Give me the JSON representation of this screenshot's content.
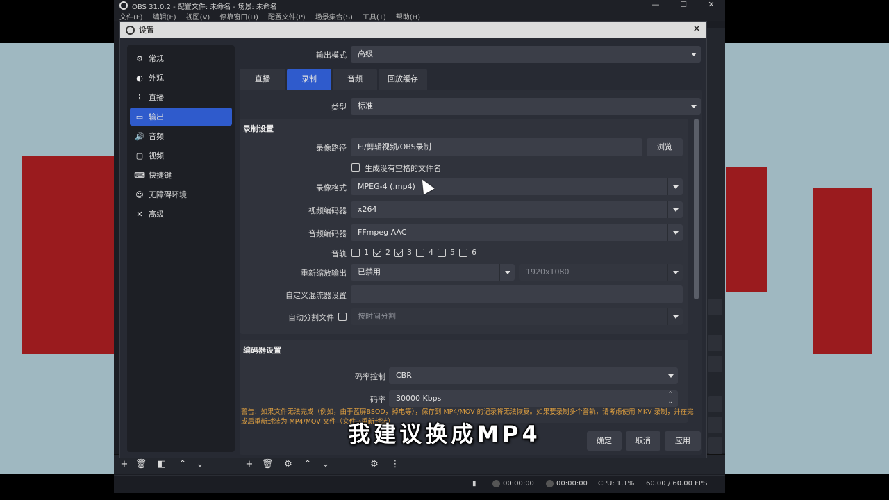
{
  "app": {
    "title": "OBS 31.0.2 - 配置文件: 未命名 - 场景: 未命名",
    "menu": [
      "文件(F)",
      "编辑(E)",
      "视图(V)",
      "停靠窗口(D)",
      "配置文件(P)",
      "场景集合(S)",
      "工具(T)",
      "帮助(H)"
    ],
    "window_controls": [
      "—",
      "☐",
      "✕"
    ],
    "status": {
      "rec_time": "00:00:00",
      "stream_time": "00:00:00",
      "cpu": "CPU: 1.1%",
      "fps": "60.00 / 60.00 FPS"
    }
  },
  "dialog": {
    "title": "设置",
    "close": "✕",
    "sidebar": [
      {
        "label": "常规",
        "icon": "gear-icon",
        "glyph": "⚙"
      },
      {
        "label": "外观",
        "icon": "appearance-icon",
        "glyph": "◐"
      },
      {
        "label": "直播",
        "icon": "broadcast-icon",
        "glyph": "⌇"
      },
      {
        "label": "输出",
        "icon": "output-icon",
        "glyph": "▭",
        "active": true
      },
      {
        "label": "音频",
        "icon": "speaker-icon",
        "glyph": "🔊"
      },
      {
        "label": "视频",
        "icon": "monitor-icon",
        "glyph": "▢"
      },
      {
        "label": "快捷键",
        "icon": "keyboard-icon",
        "glyph": "⌨"
      },
      {
        "label": "无障碍环境",
        "icon": "accessibility-icon",
        "glyph": "☺"
      },
      {
        "label": "高级",
        "icon": "tools-icon",
        "glyph": "✕"
      }
    ],
    "output_mode_label": "输出模式",
    "output_mode_value": "高级",
    "tabs": [
      "直播",
      "录制",
      "音频",
      "回放缓存"
    ],
    "active_tab": 1,
    "type_label": "类型",
    "type_value": "标准",
    "recording": {
      "group_title": "录制设置",
      "path_label": "录像路径",
      "path_value": "F:/剪辑视频/OBS录制",
      "browse": "浏览",
      "nospace_label": "生成没有空格的文件名",
      "format_label": "录像格式",
      "format_value": "MPEG-4 (.mp4)",
      "video_encoder_label": "视频编码器",
      "video_encoder_value": "x264",
      "audio_encoder_label": "音频编码器",
      "audio_encoder_value": "FFmpeg AAC",
      "tracks_label": "音轨",
      "tracks": [
        {
          "n": "1",
          "checked": false
        },
        {
          "n": "2",
          "checked": true
        },
        {
          "n": "3",
          "checked": true
        },
        {
          "n": "4",
          "checked": false
        },
        {
          "n": "5",
          "checked": false
        },
        {
          "n": "6",
          "checked": false
        }
      ],
      "rescale_label": "重新缩放输出",
      "rescale_value": "已禁用",
      "rescale_res": "1920x1080",
      "mux_label": "自定义混流器设置",
      "split_label": "自动分割文件",
      "split_value": "按时间分割"
    },
    "encoder": {
      "group_title": "编码器设置",
      "rate_control_label": "码率控制",
      "rate_control_value": "CBR",
      "bitrate_label": "码率",
      "bitrate_value": "30000 Kbps"
    },
    "warning": "警告：如果文件无法完成（例如，由于蓝屏BSOD，掉电等），保存到 MP4/MOV 的记录将无法恢复。如果要录制多个音轨，请考虑使用 MKV 录制，并在完成后重新封装为 MP4/MOV 文件（文件→重新封装）",
    "buttons": {
      "ok": "确定",
      "cancel": "取消",
      "apply": "应用"
    }
  },
  "subtitle": "我建议换成MP4",
  "colors": {
    "accent": "#2f5bcc",
    "warning": "#e0a040",
    "bg_red": "#9a1b1e"
  }
}
